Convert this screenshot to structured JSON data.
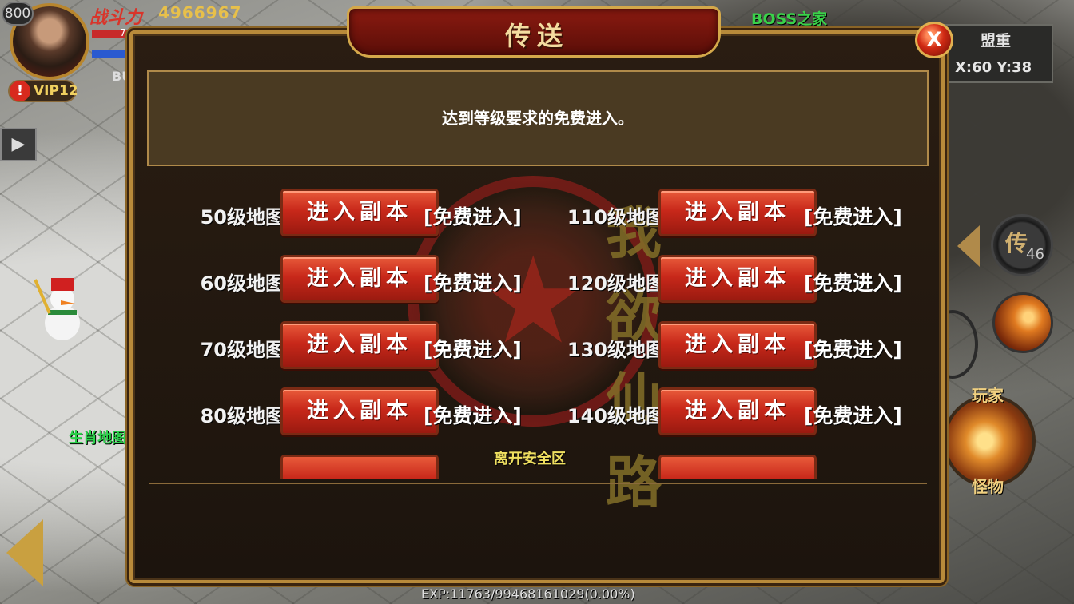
{
  "hud": {
    "level": "800",
    "power_label": "战斗力",
    "power_value": "4966967",
    "hp_partial": "7",
    "bu_text": "BU",
    "vip": "VIP12",
    "alert": "!",
    "play_glyph": "▶",
    "zodiac_map": "生肖地图",
    "exp": "EXP:11763/99468161029(0.00%)",
    "boss_home": "BOSS之家",
    "map_name": "盟重",
    "coords": "X:60 Y:38",
    "skill_glyph": "传",
    "skill_count": "46",
    "mode_player": "玩家",
    "mode_monster": "怪物"
  },
  "dialog": {
    "title": "传送",
    "close_label": "X",
    "notice": "达到等级要求的免费进入。",
    "leave_safe_zone": "离开安全区",
    "watermark_chars": "我欲仙路",
    "rows": [
      {
        "label": "50级地图",
        "button": "进入副本",
        "tag": "[免费进入]"
      },
      {
        "label": "60级地图",
        "button": "进入副本",
        "tag": "[免费进入]"
      },
      {
        "label": "70级地图",
        "button": "进入副本",
        "tag": "[免费进入]"
      },
      {
        "label": "80级地图",
        "button": "进入副本",
        "tag": "[免费进入]"
      },
      {
        "label": "110级地图",
        "button": "进入副本",
        "tag": "[免费进入]"
      },
      {
        "label": "120级地图",
        "button": "进入副本",
        "tag": "[免费进入]"
      },
      {
        "label": "130级地图",
        "button": "进入副本",
        "tag": "[免费进入]"
      },
      {
        "label": "140级地图",
        "button": "进入副本",
        "tag": "[免费进入]"
      }
    ]
  },
  "colors": {
    "accent_gold": "#b88a3a",
    "button_red": "#c8281a",
    "notice_text": "#ffffff",
    "leave_text": "#f0e060"
  }
}
